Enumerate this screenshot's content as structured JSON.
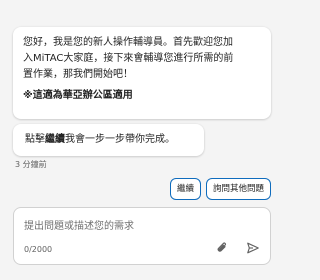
{
  "messages": [
    {
      "lines": [
        "您好，我是您的新人操作輔導員。首先歡迎您加",
        "入MiTAC大家庭，接下來會輔導您進行所需的前",
        "置作業，那我們開始吧！"
      ],
      "note": "※這適為華亞辦公區適用"
    },
    {
      "prefix": "點擊",
      "bold": "繼續",
      "suffix": "我會一步一步帶你完成。"
    }
  ],
  "timestamp": "3 分鐘前",
  "suggestions": [
    "繼續",
    "詢問其他問題"
  ],
  "composer": {
    "placeholder": "提出問題或描述您的需求",
    "char_count": "0/2000"
  },
  "icons": {
    "attach": "paperclip-icon",
    "send": "send-icon"
  },
  "colors": {
    "accent": "#0f6cbd",
    "background": "#f4f4f4"
  }
}
